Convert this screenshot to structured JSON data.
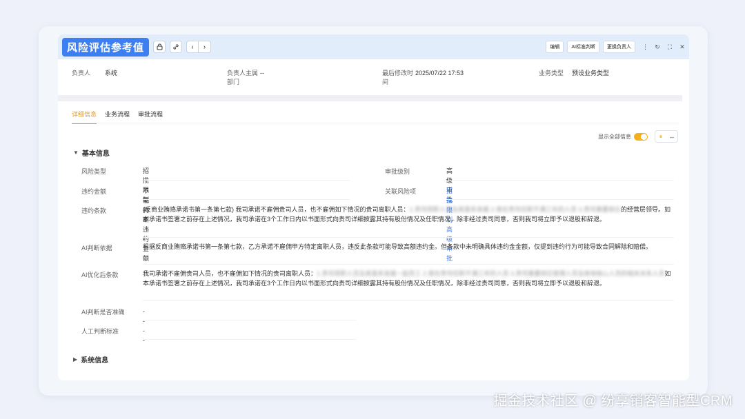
{
  "header": {
    "title": "风险评估参考值",
    "actions": [
      "编辑",
      "AI标准判断",
      "更换负责人"
    ]
  },
  "meta": {
    "owner_label": "负责人",
    "owner_value": "系统",
    "dept_label": "负责人主属部门",
    "dept_value": "--",
    "modified_label": "最后修改时间",
    "modified_value": "2025/07/22 17:53",
    "biztype_label": "业务类型",
    "biztype_value": "预设业务类型"
  },
  "tabs": [
    "详细信息",
    "业务流程",
    "审批流程"
  ],
  "show_all_label": "显示全部信息",
  "sections": {
    "basic": "基本信息",
    "system": "系统信息"
  },
  "fields": {
    "risk_type_label": "风险类型",
    "risk_type_value": "招揽限制",
    "approval_level_label": "审批级别",
    "approval_level_value": "高级审批",
    "amount_label": "违约金额",
    "amount_value": "不能判断违约金额",
    "related_label": "关联风险项",
    "related_value": "招揽限制-高级审批",
    "clause_label": "违约条款",
    "clause_value_a": "(反商业贿赂承诺书第一条第七款) 我司承诺不雇佣贵司人员，也不雇佣如下情况的贵司离职人员：",
    "clause_value_b": "的经营层领导。如本承诺书签署之前存在上述情况，我司承诺在3个工作日内以书面形式向贵司详细披露其持有股份情况及任职情况，除非经过贵司同意，否则我司将立即予以退股和辞退。",
    "basis_label": "AI判断依据",
    "basis_value": "根据反商业贿赂承诺书第一条第七款，乙方承诺不雇佣甲方特定离职人员，违反此条款可能导致高额违约金。但条款中未明确具体违约金金额，仅提到违约行为可能导致合同解除和赔偿。",
    "optimized_label": "AI优化后条款",
    "optimized_value_a": "我司承诺不雇佣贵司人员，也不雇佣如下情况的贵司离职人员：",
    "optimized_value_b": "如本承诺书签署之前存在上述情况，我司承诺在3个工作日内以书面形式向贵司详细披露其持有股份情况及任职情况，除非经过贵司同意，否则我司将立即予以退股和辞退。",
    "accurate_label": "AI判断是否准确",
    "accurate_value": "--",
    "manual_label": "人工判断标准",
    "manual_value": "--"
  },
  "watermark": "掘金技术社区 @ 纷享销客智能型CRM",
  "colors": {
    "accent": "#3d7ff0",
    "active_tab": "#e89b1e",
    "toggle": "#f5b11c"
  }
}
